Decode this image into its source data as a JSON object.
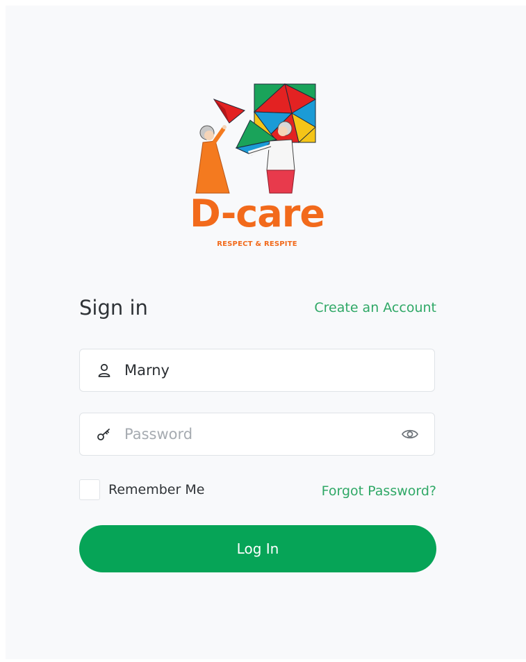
{
  "brand": {
    "name": "D-care",
    "tagline": "RESPECT & RESPITE"
  },
  "form": {
    "title": "Sign in",
    "create_account_label": "Create an Account",
    "username": {
      "value": "Marny",
      "icon": "user-icon"
    },
    "password": {
      "placeholder": "Password",
      "value": "",
      "icon": "key-icon",
      "toggle_icon": "eye-icon"
    },
    "remember_label": "Remember Me",
    "remember_checked": false,
    "forgot_label": "Forgot Password?",
    "login_label": "Log In"
  },
  "colors": {
    "brand_orange": "#f26a1b",
    "accent_green": "#06a457",
    "link_green": "#2fa866"
  }
}
